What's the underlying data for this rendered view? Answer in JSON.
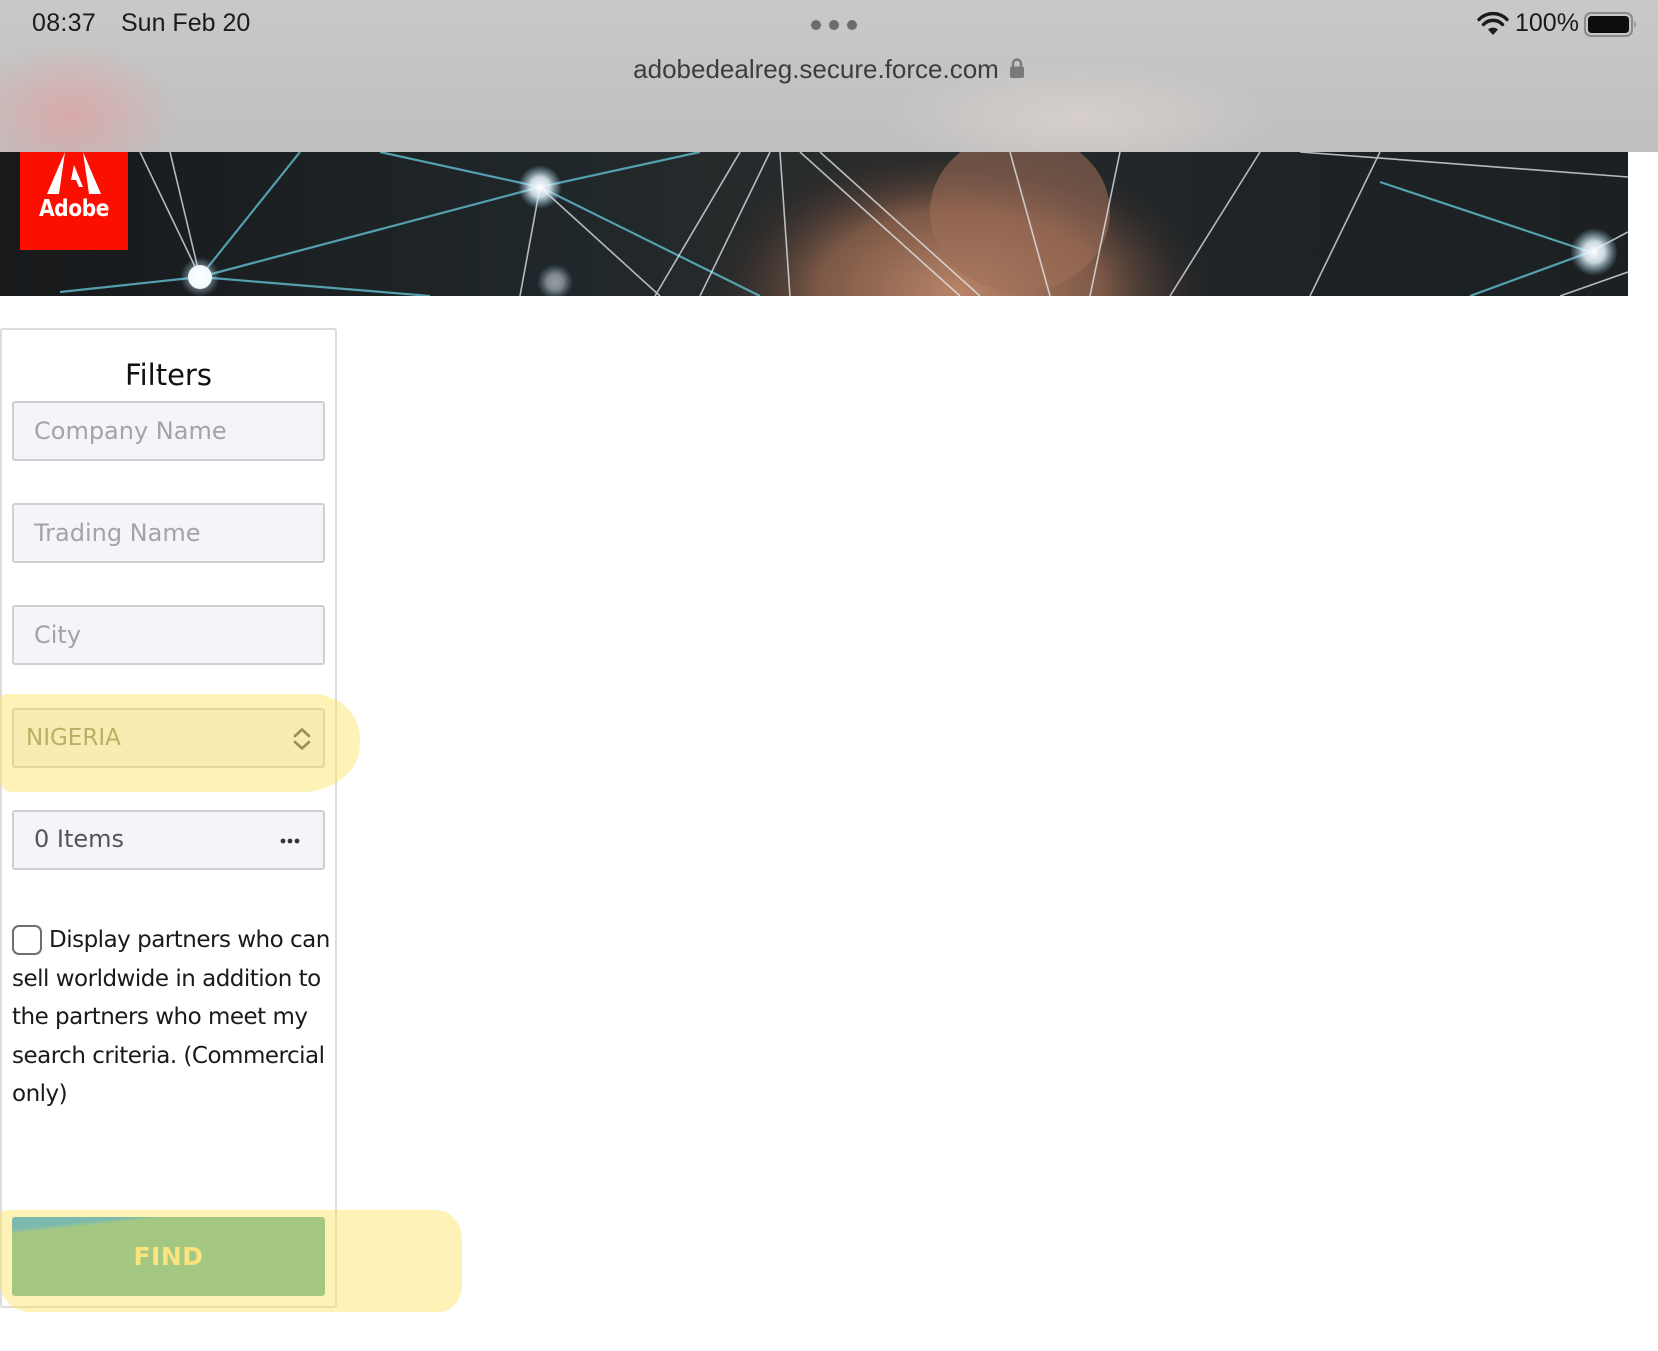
{
  "status_bar": {
    "time": "08:37",
    "date": "Sun Feb 20",
    "battery": "100%",
    "icons": [
      "wifi-icon",
      "battery-icon",
      "more-dots-icon"
    ]
  },
  "browser": {
    "url": "adobedealreg.secure.force.com",
    "url_icon": "lock-icon"
  },
  "header": {
    "logo_text": "Adobe",
    "logo_color": "#fa0f00"
  },
  "filters": {
    "title": "Filters",
    "company_name": {
      "value": "",
      "placeholder": "Company Name"
    },
    "trading_name": {
      "value": "",
      "placeholder": "Trading Name"
    },
    "city": {
      "value": "",
      "placeholder": "City"
    },
    "country": {
      "selected": "NIGERIA",
      "icon": "chevron-updown-icon"
    },
    "items": {
      "value": "0 Items",
      "icon": "ellipsis-icon"
    },
    "worldwide_checkbox": {
      "checked": false,
      "label": "Display partners who can sell worldwide in addition to the partners who meet my search criteria. (Commercial only)"
    },
    "find_button": "FIND"
  },
  "colors": {
    "find_button": "#64b7a4",
    "find_text": "#f7e79c",
    "highlight": "#ffe050"
  }
}
